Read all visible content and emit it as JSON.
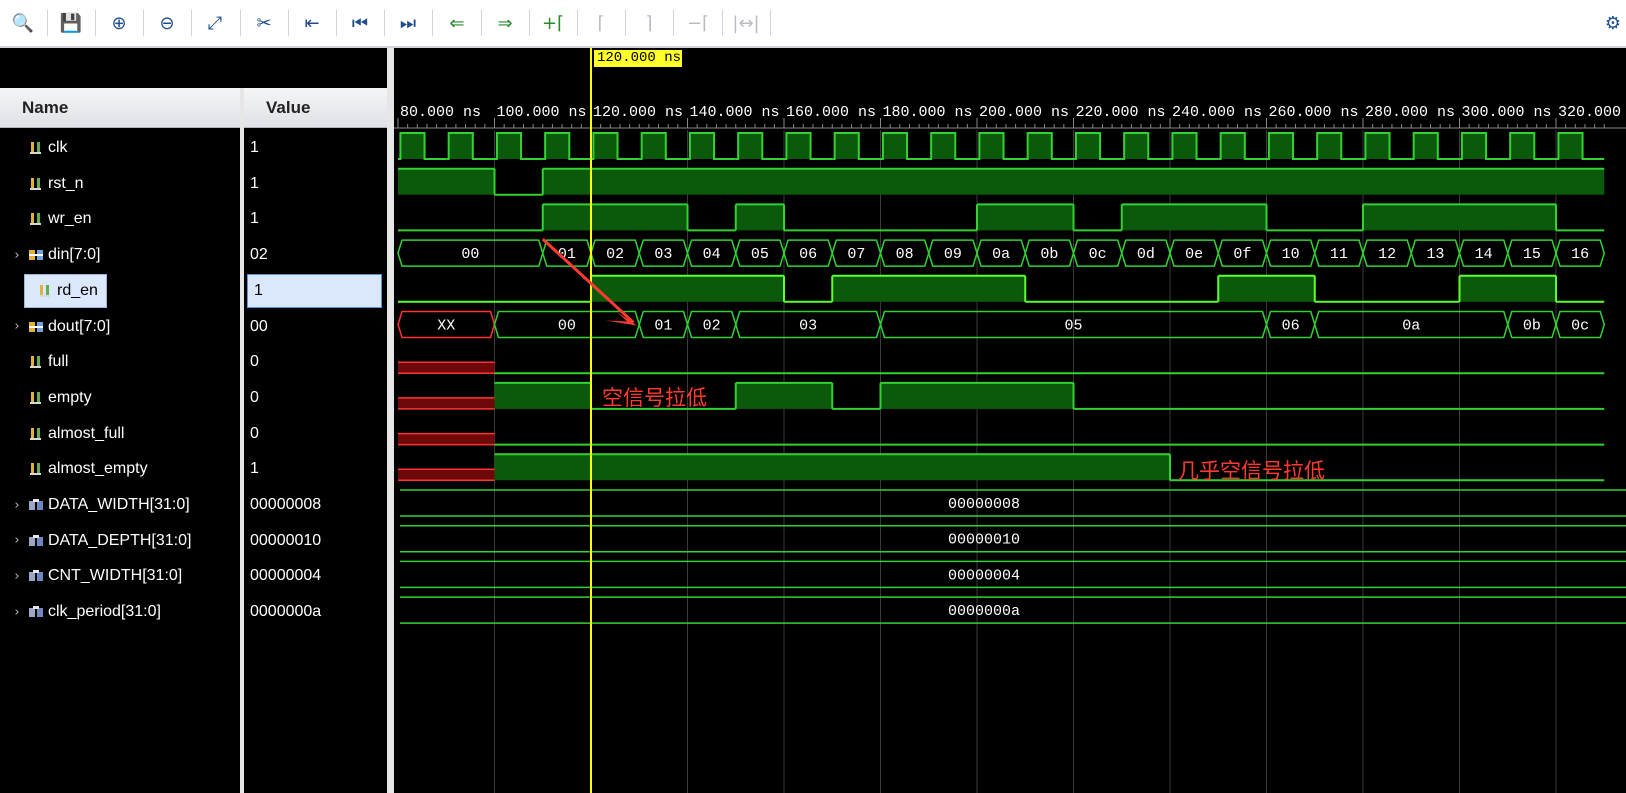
{
  "toolbar": {
    "buttons": [
      {
        "icon": "search-icon",
        "glyph": "🔍",
        "state": "enabled"
      },
      {
        "icon": "save-icon",
        "glyph": "💾",
        "state": "enabled"
      },
      {
        "icon": "zoom-in-icon",
        "glyph": "⊕",
        "state": "enabled"
      },
      {
        "icon": "zoom-out-icon",
        "glyph": "⊖",
        "state": "enabled"
      },
      {
        "icon": "zoom-fit-icon",
        "glyph": "⤢",
        "state": "enabled"
      },
      {
        "icon": "go-to-cursor-icon",
        "glyph": "✂",
        "state": "enabled"
      },
      {
        "icon": "previous-transition-icon",
        "glyph": "⇤",
        "state": "enabled"
      },
      {
        "icon": "go-to-start-icon",
        "glyph": "⏮",
        "state": "enabled"
      },
      {
        "icon": "go-to-end-icon",
        "glyph": "⏭",
        "state": "enabled"
      },
      {
        "icon": "previous-edge-icon",
        "glyph": "⇐",
        "state": "enabled-green"
      },
      {
        "icon": "next-edge-icon",
        "glyph": "⇒",
        "state": "enabled-green"
      },
      {
        "icon": "add-marker-icon",
        "glyph": "+⌈",
        "state": "enabled-green"
      },
      {
        "icon": "previous-marker-icon",
        "glyph": "⌈",
        "state": "disabled"
      },
      {
        "icon": "next-marker-icon",
        "glyph": "⌉",
        "state": "disabled"
      },
      {
        "icon": "delete-marker-icon",
        "glyph": "−⌈",
        "state": "disabled"
      },
      {
        "icon": "marker-distance-icon",
        "glyph": "|↔|",
        "state": "disabled"
      }
    ],
    "settings_icon": "gear-icon",
    "settings_glyph": "⚙"
  },
  "headers": {
    "name": "Name",
    "value": "Value"
  },
  "cursor_time": "120.000 ns",
  "timeline": {
    "labels": [
      "80.000 ns",
      "100.000 ns",
      "120.000 ns",
      "140.000 ns",
      "160.000 ns",
      "180.000 ns",
      "200.000 ns",
      "220.000 ns",
      "240.000 ns",
      "260.000 ns",
      "280.000 ns",
      "300.000 ns",
      "320.000 ns"
    ]
  },
  "signals": [
    {
      "name": "clk",
      "value": "1",
      "kind": "bit",
      "expandable": false,
      "icon": "bit-signal-icon"
    },
    {
      "name": "rst_n",
      "value": "1",
      "kind": "bit",
      "expandable": false,
      "icon": "bit-signal-icon"
    },
    {
      "name": "wr_en",
      "value": "1",
      "kind": "bit",
      "expandable": false,
      "icon": "bit-signal-icon"
    },
    {
      "name": "din[7:0]",
      "value": "02",
      "kind": "bus",
      "expandable": true,
      "icon": "bus-signal-icon"
    },
    {
      "name": "rd_en",
      "value": "1",
      "kind": "bit",
      "expandable": false,
      "icon": "bit-signal-icon",
      "selected": true
    },
    {
      "name": "dout[7:0]",
      "value": "00",
      "kind": "bus",
      "expandable": true,
      "icon": "bus-signal-icon"
    },
    {
      "name": "full",
      "value": "0",
      "kind": "bit",
      "expandable": false,
      "icon": "bit-output-icon"
    },
    {
      "name": "empty",
      "value": "0",
      "kind": "bit",
      "expandable": false,
      "icon": "bit-output-icon"
    },
    {
      "name": "almost_full",
      "value": "0",
      "kind": "bit",
      "expandable": false,
      "icon": "bit-output-icon"
    },
    {
      "name": "almost_empty",
      "value": "1",
      "kind": "bit",
      "expandable": false,
      "icon": "bit-output-icon"
    },
    {
      "name": "DATA_WIDTH[31:0]",
      "value": "00000008",
      "kind": "param",
      "expandable": true,
      "icon": "parameter-icon"
    },
    {
      "name": "DATA_DEPTH[31:0]",
      "value": "00000010",
      "kind": "param",
      "expandable": true,
      "icon": "parameter-icon"
    },
    {
      "name": "CNT_WIDTH[31:0]",
      "value": "00000004",
      "kind": "param",
      "expandable": true,
      "icon": "parameter-icon"
    },
    {
      "name": "clk_period[31:0]",
      "value": "0000000a",
      "kind": "param",
      "expandable": true,
      "icon": "parameter-icon"
    }
  ],
  "waves": {
    "rst_n": {
      "undefined_before_ns": null,
      "segments": [
        [
          80,
          100,
          1
        ],
        [
          100,
          110,
          0
        ],
        [
          110,
          330,
          1
        ]
      ]
    },
    "wr_en": {
      "segments": [
        [
          80,
          110,
          0
        ],
        [
          110,
          140,
          1
        ],
        [
          140,
          150,
          0
        ],
        [
          150,
          160,
          1
        ],
        [
          160,
          180,
          0
        ],
        [
          180,
          200,
          0
        ],
        [
          200,
          220,
          1
        ],
        [
          220,
          230,
          0
        ],
        [
          230,
          260,
          1
        ],
        [
          260,
          280,
          0
        ],
        [
          280,
          320,
          1
        ],
        [
          320,
          330,
          0
        ]
      ]
    },
    "rd_en": {
      "segments": [
        [
          80,
          120,
          0
        ],
        [
          120,
          160,
          1
        ],
        [
          160,
          170,
          0
        ],
        [
          170,
          210,
          1
        ],
        [
          210,
          250,
          0
        ],
        [
          250,
          270,
          1
        ],
        [
          270,
          300,
          0
        ],
        [
          300,
          320,
          1
        ],
        [
          320,
          330,
          0
        ]
      ]
    },
    "empty": {
      "undefined_until_ns": 100,
      "segments": [
        [
          100,
          120,
          1
        ],
        [
          120,
          150,
          0
        ],
        [
          150,
          170,
          1
        ],
        [
          170,
          180,
          0
        ],
        [
          180,
          220,
          1
        ],
        [
          220,
          330,
          0
        ]
      ]
    },
    "full": {
      "undefined_until_ns": 100,
      "segments": [
        [
          100,
          330,
          0
        ]
      ]
    },
    "almost_full": {
      "undefined_until_ns": 100,
      "segments": [
        [
          100,
          330,
          0
        ]
      ]
    },
    "almost_empty": {
      "undefined_until_ns": 100,
      "segments": [
        [
          100,
          240,
          1
        ],
        [
          240,
          330,
          0
        ]
      ]
    },
    "din": [
      [
        80,
        110,
        "00"
      ],
      [
        110,
        120,
        "01"
      ],
      [
        120,
        130,
        "02"
      ],
      [
        130,
        140,
        "03"
      ],
      [
        140,
        150,
        "04"
      ],
      [
        150,
        160,
        "05"
      ],
      [
        160,
        170,
        "06"
      ],
      [
        170,
        180,
        "07"
      ],
      [
        180,
        190,
        "08"
      ],
      [
        190,
        200,
        "09"
      ],
      [
        200,
        210,
        "0a"
      ],
      [
        210,
        220,
        "0b"
      ],
      [
        220,
        230,
        "0c"
      ],
      [
        230,
        240,
        "0d"
      ],
      [
        240,
        250,
        "0e"
      ],
      [
        250,
        260,
        "0f"
      ],
      [
        260,
        270,
        "10"
      ],
      [
        270,
        280,
        "11"
      ],
      [
        280,
        290,
        "12"
      ],
      [
        290,
        300,
        "13"
      ],
      [
        300,
        310,
        "14"
      ],
      [
        310,
        320,
        "15"
      ],
      [
        320,
        330,
        "16"
      ]
    ],
    "dout": [
      [
        80,
        100,
        "XX"
      ],
      [
        100,
        130,
        "00"
      ],
      [
        130,
        140,
        "01"
      ],
      [
        140,
        150,
        "02"
      ],
      [
        150,
        180,
        "03"
      ],
      [
        180,
        260,
        "05"
      ],
      [
        260,
        270,
        "06"
      ],
      [
        270,
        310,
        "0a"
      ],
      [
        310,
        320,
        "0b"
      ],
      [
        320,
        330,
        "0c"
      ]
    ],
    "DATA_WIDTH": "00000008",
    "DATA_DEPTH": "00000010",
    "CNT_WIDTH": "00000004",
    "clk_period": "0000000a"
  },
  "annotations": {
    "empty_low": "空信号拉低",
    "almost_empty_low": "几乎空信号拉低"
  },
  "colors": {
    "wave_line": "#32d232",
    "wave_fill": "#0b5a0b",
    "wave_bright": "#5dff2b",
    "undefined": "#ff3333",
    "undefined_fill": "#6e0909",
    "cursor": "#ffff00",
    "annotation": "#ff3b30",
    "selected_bg": "#dbe7fb"
  }
}
